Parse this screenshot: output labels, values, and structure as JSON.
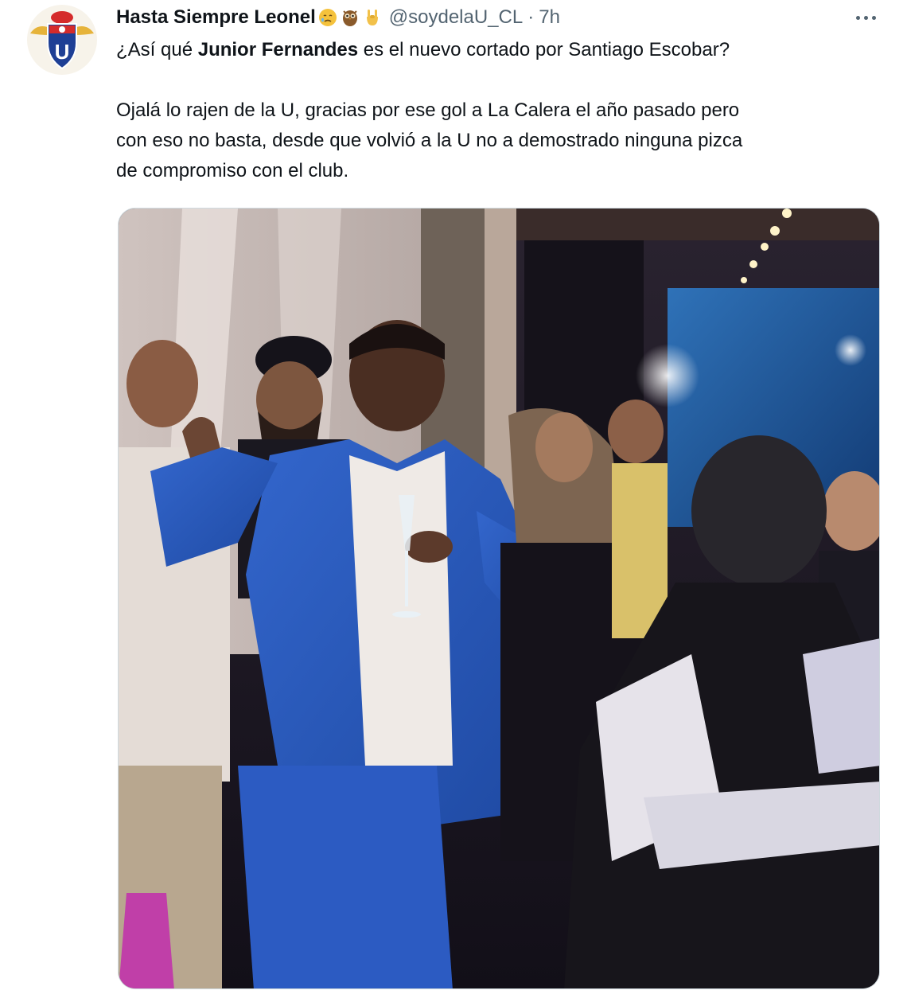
{
  "author": {
    "display_name": "Hasta Siempre Leonel",
    "handle": "@soydelaU_CL",
    "separator": "·",
    "time": "7h",
    "emojis": [
      "sad-face-emoji",
      "owl-emoji",
      "rock-hand-emoji"
    ]
  },
  "tweet": {
    "line1_pre": "¿Así qué ",
    "line1_bold": "Junior Fernandes",
    "line1_post": " es el nuevo cortado por Santiago Escobar?",
    "para2_line1": "Ojalá lo rajen de la U, gracias por ese gol a La Calera el año pasado pero",
    "para2_line2": "con eso no basta, desde que volvió a la U no a demostrado ninguna pizca",
    "para2_line3": "de compromiso con el club."
  },
  "avatar_logo_letter": "U",
  "colors": {
    "text": "#0f1419",
    "secondary": "#536471",
    "blazer": "#2a57b8",
    "club_blue": "#1e3f95",
    "club_red": "#d52b2b",
    "club_gold": "#e6b33a"
  }
}
